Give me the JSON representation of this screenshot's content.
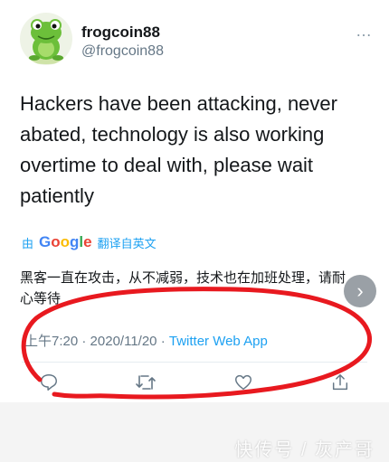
{
  "user": {
    "name": "frogcoin88",
    "handle": "@frogcoin88"
  },
  "tweet": {
    "text": "Hackers have been attacking, never abated, technology is also working overtime to deal with, please wait patiently",
    "translate_prefix": "由",
    "translate_brand": "Google",
    "translate_suffix": "翻译自英文",
    "translated_text": "黑客一直在攻击，从不减弱，技术也在加班处理，请耐心等待",
    "time": "上午7:20",
    "date": "2020/11/20",
    "separator": "·",
    "app": "Twitter Web App"
  },
  "more_icon": "…",
  "next_icon": "›",
  "watermark": "快传号 / 灰产哥",
  "icons": [
    "frog-avatar",
    "more-icon",
    "reply-icon",
    "retweet-icon",
    "like-icon",
    "share-icon",
    "chevron-right-icon"
  ],
  "colors": {
    "link": "#1da1f2",
    "secondary": "#657786",
    "annotation": "#e8191f"
  }
}
